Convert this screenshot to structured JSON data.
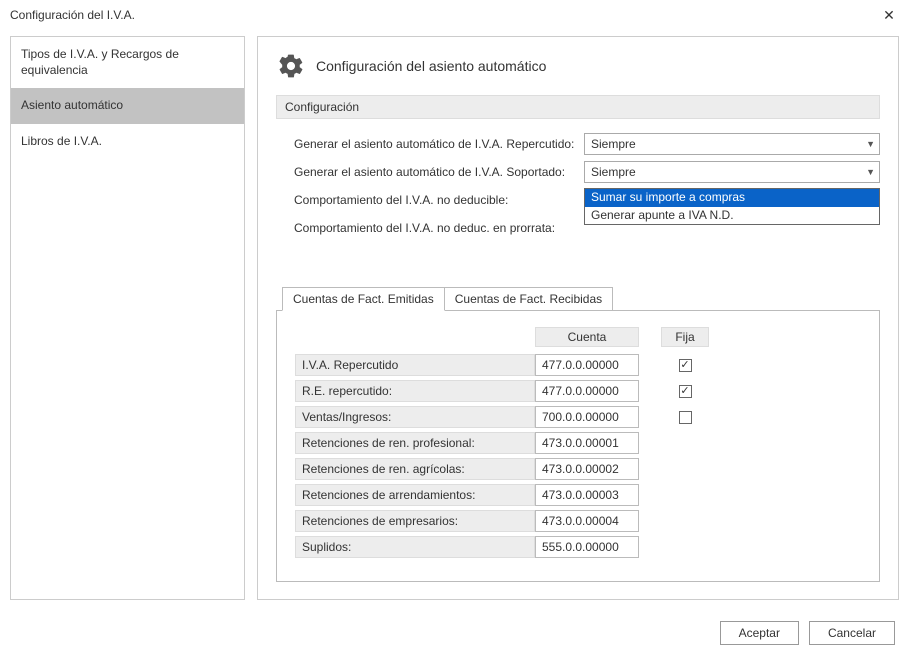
{
  "window": {
    "title": "Configuración del I.V.A."
  },
  "sidebar": {
    "items": [
      {
        "label": "Tipos de I.V.A. y Recargos de equivalencia",
        "selected": false
      },
      {
        "label": "Asiento automático",
        "selected": true
      },
      {
        "label": "Libros de I.V.A.",
        "selected": false
      }
    ]
  },
  "main": {
    "heading": "Configuración del asiento automático",
    "section_label": "Configuración",
    "fields": {
      "repercutido": {
        "label": "Generar el asiento automático de I.V.A. Repercutido:",
        "value": "Siempre"
      },
      "soportado": {
        "label": "Generar el asiento automático de I.V.A. Soportado:",
        "value": "Siempre"
      },
      "no_deducible": {
        "label": "Comportamiento del I.V.A. no deducible:",
        "value": "Sumar su importe a compras"
      },
      "prorrata": {
        "label": "Comportamiento del I.V.A. no deduc. en prorrata:",
        "value": ""
      }
    },
    "dropdown_open": {
      "options": [
        "Sumar su importe a compras",
        "Generar apunte a IVA N.D."
      ],
      "highlighted_index": 0
    },
    "tabs": [
      {
        "label": "Cuentas de Fact. Emitidas",
        "active": true
      },
      {
        "label": "Cuentas de Fact. Recibidas",
        "active": false
      }
    ],
    "table": {
      "headers": {
        "cuenta": "Cuenta",
        "fija": "Fija"
      },
      "rows": [
        {
          "label": "I.V.A. Repercutido",
          "cuenta": "477.0.0.00000",
          "fija": true
        },
        {
          "label": "R.E. repercutido:",
          "cuenta": "477.0.0.00000",
          "fija": true
        },
        {
          "label": "Ventas/Ingresos:",
          "cuenta": "700.0.0.00000",
          "fija": false
        },
        {
          "label": "Retenciones de ren. profesional:",
          "cuenta": "473.0.0.00001",
          "fija": null
        },
        {
          "label": "Retenciones de ren. agrícolas:",
          "cuenta": "473.0.0.00002",
          "fija": null
        },
        {
          "label": "Retenciones de arrendamientos:",
          "cuenta": "473.0.0.00003",
          "fija": null
        },
        {
          "label": "Retenciones de empresarios:",
          "cuenta": "473.0.0.00004",
          "fija": null
        },
        {
          "label": "Suplidos:",
          "cuenta": "555.0.0.00000",
          "fija": null
        }
      ]
    }
  },
  "footer": {
    "accept": "Aceptar",
    "cancel": "Cancelar"
  }
}
